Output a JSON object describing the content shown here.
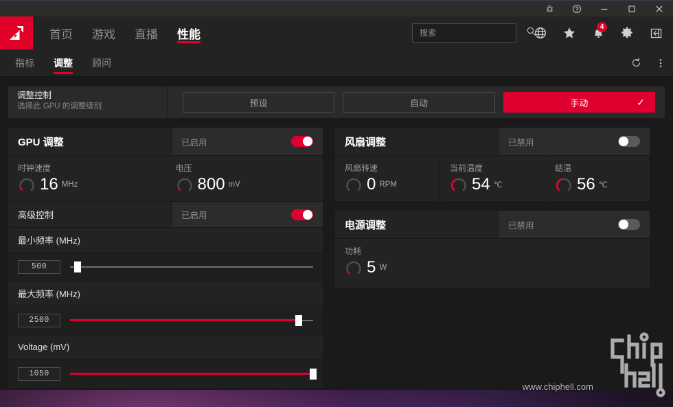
{
  "titlebar": {
    "buttons": [
      {
        "name": "bug-report-icon",
        "label": ""
      },
      {
        "name": "help-icon",
        "label": ""
      },
      {
        "name": "minimize-icon",
        "label": ""
      },
      {
        "name": "maximize-icon",
        "label": ""
      },
      {
        "name": "close-icon",
        "label": ""
      }
    ]
  },
  "nav": {
    "logo_alt": "AMD",
    "items": [
      {
        "label": "首页",
        "active": false
      },
      {
        "label": "游戏",
        "active": false
      },
      {
        "label": "直播",
        "active": false
      },
      {
        "label": "性能",
        "active": true
      }
    ],
    "search": {
      "placeholder": "搜索",
      "value": ""
    },
    "icons": [
      {
        "name": "globe-icon"
      },
      {
        "name": "star-icon"
      },
      {
        "name": "bell-icon",
        "badge": "4"
      },
      {
        "name": "gear-icon"
      },
      {
        "name": "panel-toggle-icon"
      }
    ]
  },
  "subnav": {
    "tabs": [
      {
        "label": "指标",
        "active": false
      },
      {
        "label": "调整",
        "active": true
      },
      {
        "label": "顾问",
        "active": false
      }
    ],
    "reset_icon": "reset-icon",
    "more_icon": "more-vertical-icon"
  },
  "tuning_control": {
    "title": "调整控制",
    "subtitle": "选择此 GPU 的调整级别",
    "buttons": [
      {
        "label": "预设",
        "selected": false
      },
      {
        "label": "自动",
        "selected": false
      },
      {
        "label": "手动",
        "selected": true,
        "check": "✓"
      }
    ]
  },
  "gpu_tuning": {
    "title": "GPU 调整",
    "state_label": "已启用",
    "enabled": true,
    "metrics": [
      {
        "label": "时钟速度",
        "value": "16",
        "unit": "MHz",
        "gauge_pct": 2
      },
      {
        "label": "电压",
        "value": "800",
        "unit": "mV",
        "gauge_pct": 3
      }
    ],
    "advanced": {
      "title": "高级控制",
      "state_label": "已启用",
      "enabled": true
    },
    "sliders": [
      {
        "label": "最小频率 (MHz)",
        "value": "500",
        "pct": 3,
        "filled": false
      },
      {
        "label": "最大频率 (MHz)",
        "value": "2500",
        "pct": 94,
        "filled": true
      },
      {
        "label": "Voltage (mV)",
        "value": "1050",
        "pct": 100,
        "filled": true
      }
    ]
  },
  "fan_tuning": {
    "title": "风扇调整",
    "state_label": "已禁用",
    "enabled": false,
    "metrics": [
      {
        "label": "风扇转速",
        "value": "0",
        "unit": "RPM",
        "gauge_pct": 0
      },
      {
        "label": "当前温度",
        "value": "54",
        "unit": "℃",
        "gauge_pct": 42
      },
      {
        "label": "结温",
        "value": "56",
        "unit": "℃",
        "gauge_pct": 44
      }
    ]
  },
  "power_tuning": {
    "title": "电源调整",
    "state_label": "已禁用",
    "enabled": false,
    "metrics": [
      {
        "label": "功耗",
        "value": "5",
        "unit": "W",
        "gauge_pct": 3
      }
    ]
  },
  "watermark": {
    "url": "www.chiphell.com",
    "logo_alt": "chiphell"
  },
  "colors": {
    "accent_red": "#e00030",
    "amd_red": "#e00028",
    "panel_bg": "#232323",
    "window_bg": "#1a1a1a",
    "nav_bg": "#232323"
  }
}
